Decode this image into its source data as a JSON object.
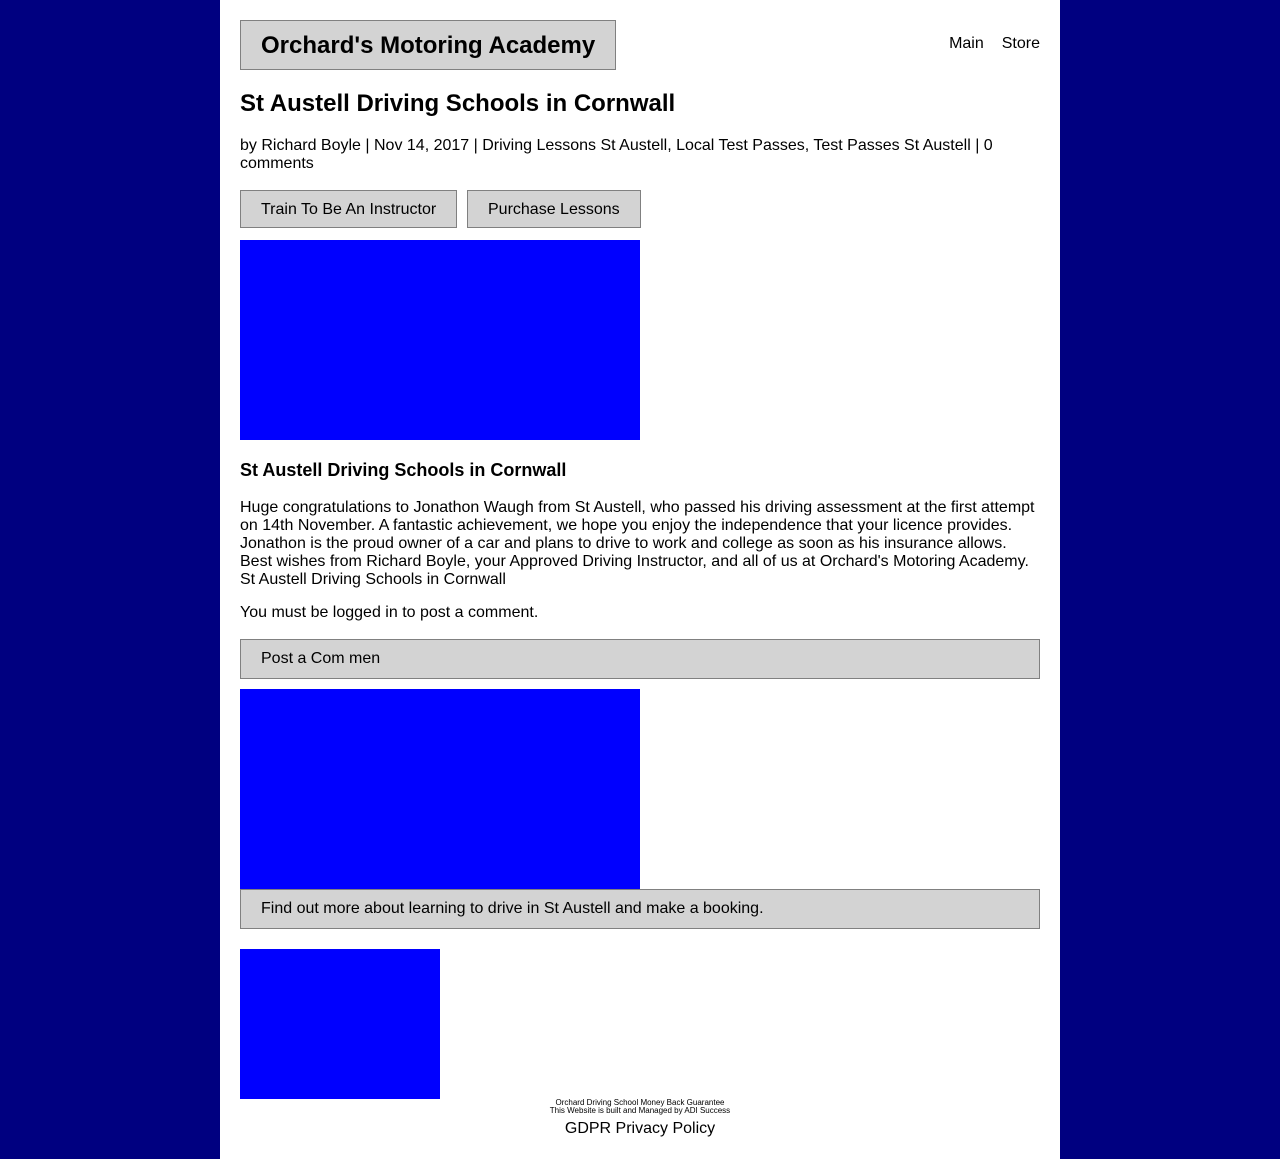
{
  "header": {
    "site_title": "Orchard's Motoring Academy",
    "nav": [
      {
        "label": "Main"
      },
      {
        "label": "Store"
      }
    ]
  },
  "post": {
    "title": "St Austell Driving Schools in Cornwall",
    "meta": "by Richard Boyle | Nov 14, 2017 | Driving Lessons St Austell, Local Test Passes, Test Passes St Austell | 0 comments",
    "buttons": {
      "train": "Train To Be An Instructor",
      "purchase": "Purchase Lessons"
    },
    "subtitle": "St Austell Driving Schools in Cornwall",
    "body": "Huge congratulations to Jonathon Waugh from St Austell, who passed his driving assessment at the first attempt on 14th November. A fantastic achievement, we hope you enjoy the independence that your licence provides. Jonathon is the proud owner of a car and plans to drive to work and college as soon as his insurance allows. Best wishes from Richard Boyle, your Approved Driving Instructor, and all of us at Orchard's Motoring Academy. St Austell Driving Schools in Cornwall"
  },
  "comments": {
    "login_note": "You must be logged in to post a comment.",
    "post_button": "Post a Com men"
  },
  "booking": {
    "find_out_button": "Find out more about learning to drive in St Austell and make a booking."
  },
  "footer": {
    "guarantee": "Orchard Driving School Money Back Guarantee",
    "built_by": "This Website is built and Managed by ADI Success",
    "gdpr_link": "GDPR Privacy Policy"
  },
  "colors": {
    "background": "#000080",
    "content_bg": "#ffffff",
    "button_bg": "#d3d3d3",
    "button_border": "#808080",
    "image_placeholder": "#0000ff"
  }
}
